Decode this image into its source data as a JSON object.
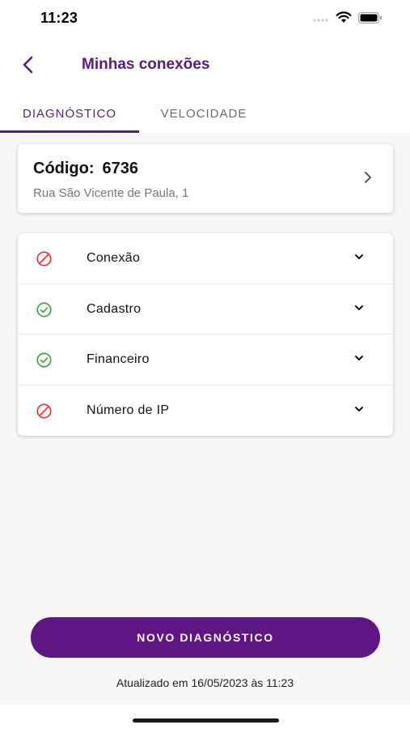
{
  "status_bar": {
    "time": "11:23",
    "icons": [
      "signal-icon",
      "wifi-icon",
      "battery-icon"
    ]
  },
  "header": {
    "back_icon": "chevron-left-icon",
    "title": "Minhas conexões"
  },
  "tabs": [
    {
      "label": "DIAGNÓSTICO",
      "active": true
    },
    {
      "label": "VELOCIDADE",
      "active": false
    }
  ],
  "connection_card": {
    "code_label": "Código:",
    "code_value": "6736",
    "address": "Rua São Vicente de Paula, 1",
    "chevron_icon": "chevron-right-icon"
  },
  "diagnostics": [
    {
      "label": "Conexão",
      "status": "error",
      "icon": "blocked-icon"
    },
    {
      "label": "Cadastro",
      "status": "ok",
      "icon": "check-circle-icon"
    },
    {
      "label": "Financeiro",
      "status": "ok",
      "icon": "check-circle-icon"
    },
    {
      "label": "Número de IP",
      "status": "error",
      "icon": "blocked-icon"
    }
  ],
  "actions": {
    "new_diagnostic_label": "NOVO DIAGNÓSTICO"
  },
  "footer": {
    "updated_text": "Atualizado em 16/05/2023 às 11:23"
  },
  "colors": {
    "brand": "#5e1782",
    "error": "#e53935",
    "success": "#43a047",
    "background": "#f6f6f6"
  }
}
